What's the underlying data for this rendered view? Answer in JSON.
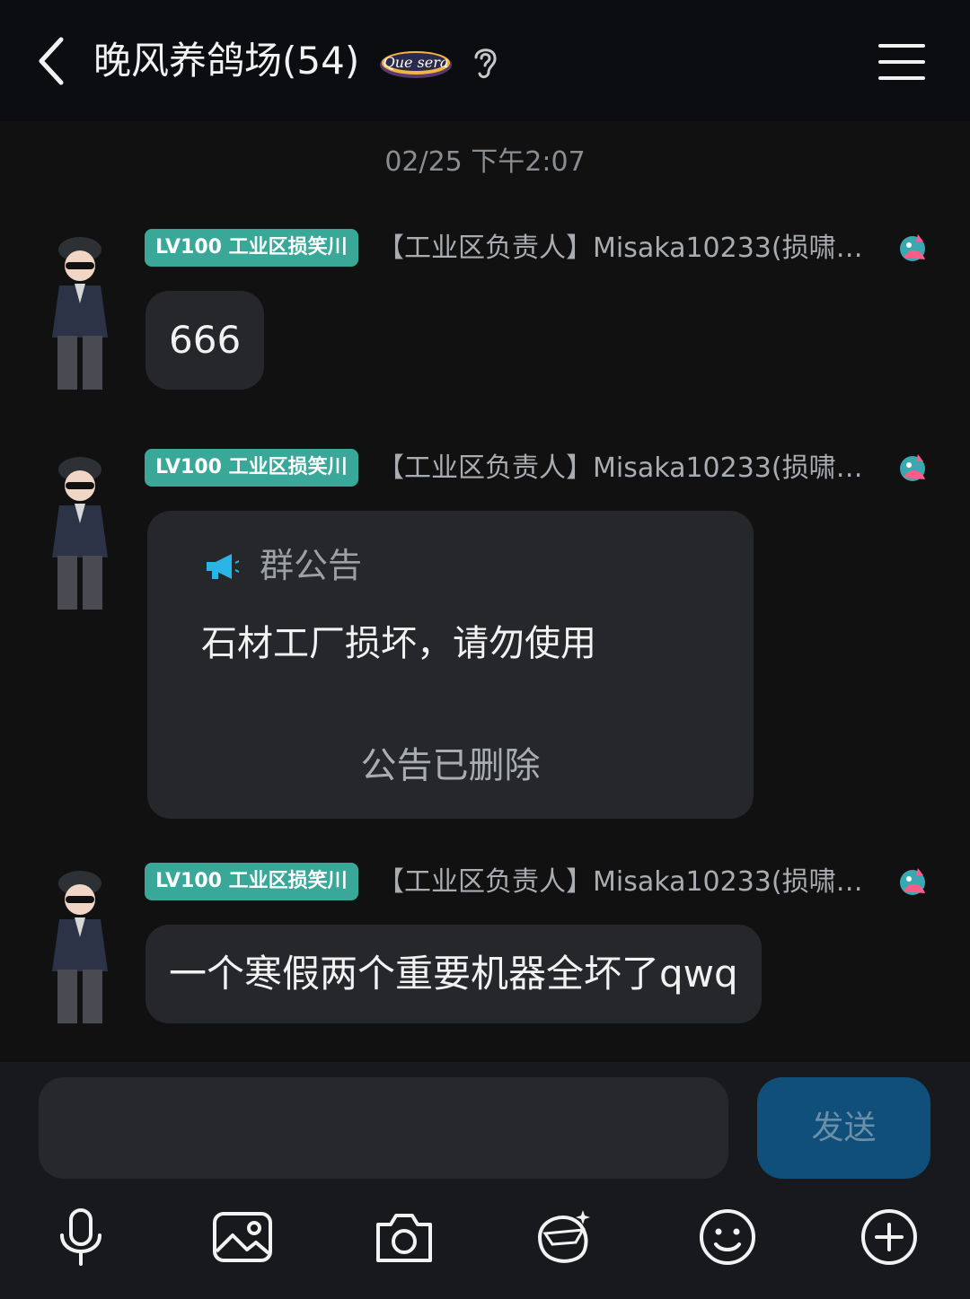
{
  "header": {
    "title": "晚风养鸽场(54)",
    "badge_text": "Que sera"
  },
  "timestamp": "02/25 下午2:07",
  "messages": [
    {
      "level_tag": "LV100 工业区损笑川",
      "sender": "【工业区负责人】Misaka10233(损啸…",
      "text": "666"
    },
    {
      "level_tag": "LV100 工业区损笑川",
      "sender": "【工业区负责人】Misaka10233(损啸…",
      "notice": {
        "title": "群公告",
        "content": "石材工厂损坏，请勿使用",
        "footer": "公告已删除"
      }
    },
    {
      "level_tag": "LV100 工业区损笑川",
      "sender": "【工业区负责人】Misaka10233(损啸…",
      "text": "一个寒假两个重要机器全坏了qwq"
    }
  ],
  "input": {
    "placeholder": "",
    "value": "",
    "send_label": "发送"
  },
  "toolbar": [
    "microphone-icon",
    "image-icon",
    "camera-icon",
    "sticker-icon",
    "emoji-icon",
    "plus-icon"
  ],
  "colors": {
    "accent_tag": "#3aa898",
    "send_button": "#0f4f7a",
    "bubble": "#25272b",
    "background": "#111111"
  }
}
